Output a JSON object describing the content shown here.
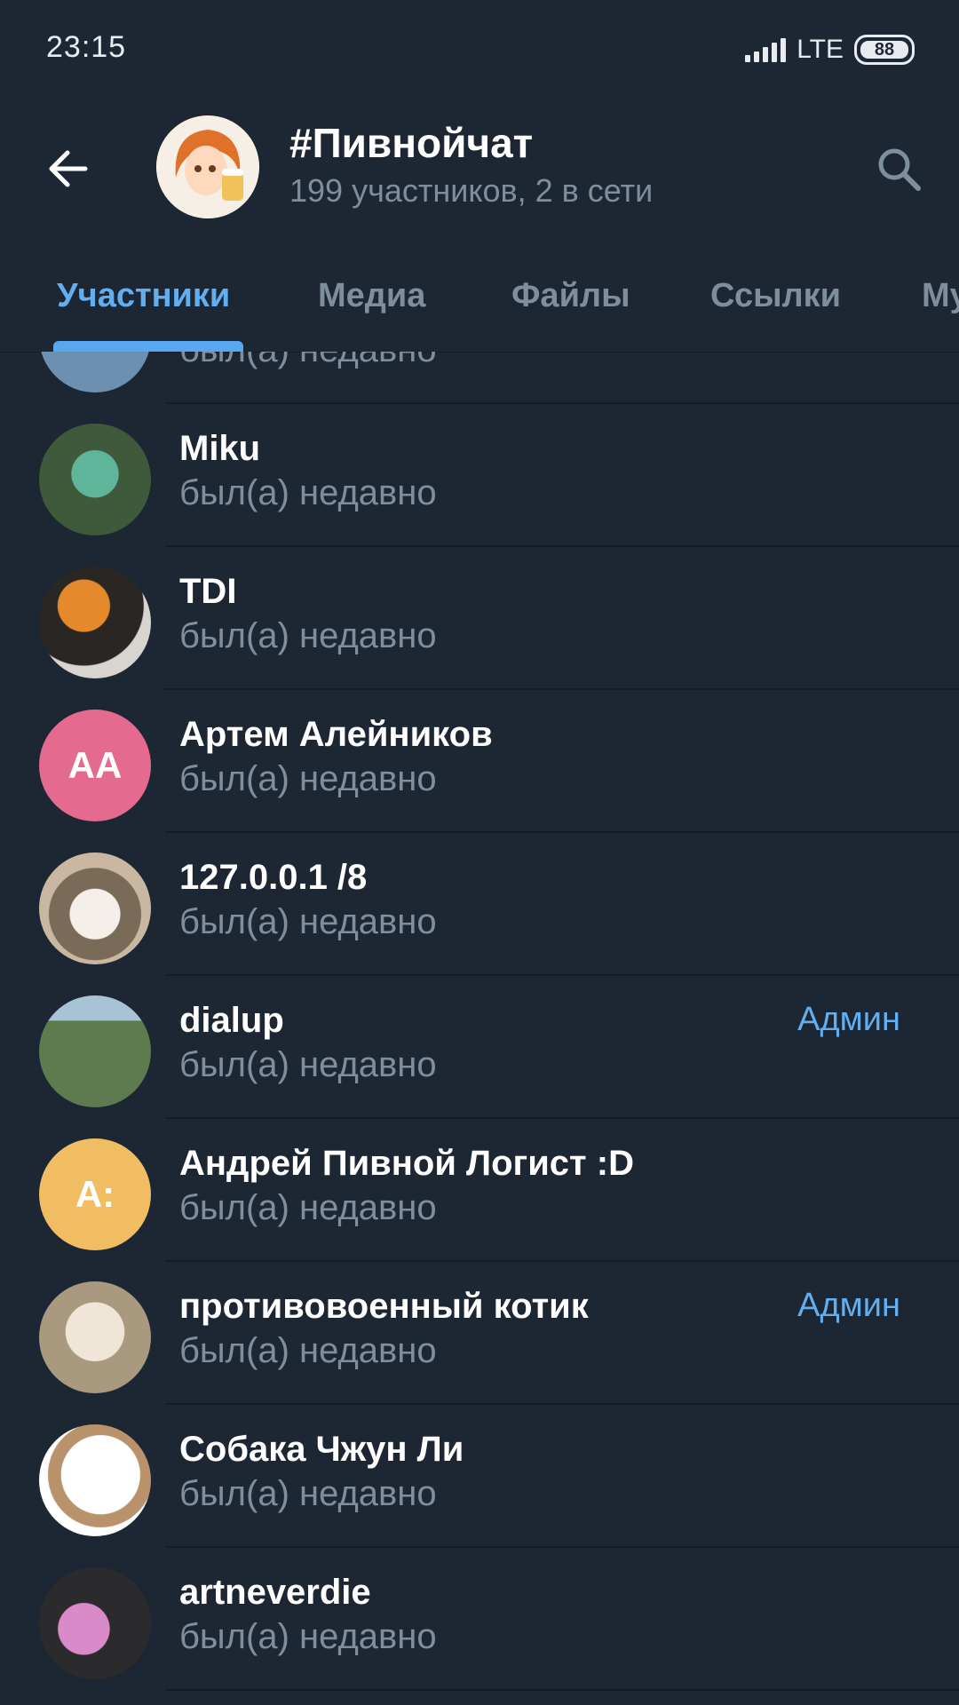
{
  "status_bar": {
    "time": "23:15",
    "network": "LTE",
    "battery": "88"
  },
  "header": {
    "title": "#Пивнойчат",
    "subtitle": "199 участников, 2 в сети"
  },
  "tabs": [
    {
      "label": "Участники",
      "active": true
    },
    {
      "label": "Медиа",
      "active": false
    },
    {
      "label": "Файлы",
      "active": false
    },
    {
      "label": "Ссылки",
      "active": false
    },
    {
      "label": "Му",
      "active": false
    }
  ],
  "members": [
    {
      "name": "",
      "status": "был(а) недавно",
      "badge": "",
      "initials": "",
      "avatar_color": "#6d8fb0"
    },
    {
      "name": "Miku",
      "status": "был(а) недавно",
      "badge": "",
      "initials": "",
      "avatar_color": "#4a6b48"
    },
    {
      "name": "TDI",
      "status": "был(а) недавно",
      "badge": "",
      "initials": "",
      "avatar_color": "#3b3633"
    },
    {
      "name": "Артем Алейников",
      "status": "был(а) недавно",
      "badge": "",
      "initials": "АА",
      "avatar_color": "#e56a8f"
    },
    {
      "name": "127.0.0.1 /8",
      "status": "был(а) недавно",
      "badge": "",
      "initials": "",
      "avatar_color": "#c9b7a2"
    },
    {
      "name": "dialup",
      "status": "был(а) недавно",
      "badge": "Админ",
      "initials": "",
      "avatar_color": "#5e7a4f"
    },
    {
      "name": "Андрей Пивной Логист :D",
      "status": "был(а) недавно",
      "badge": "",
      "initials": "А:",
      "avatar_color": "#f0bd63"
    },
    {
      "name": "противовоенный котик",
      "status": "был(а) недавно",
      "badge": "Админ",
      "initials": "",
      "avatar_color": "#c8bba5"
    },
    {
      "name": "Собака Чжун Ли",
      "status": "был(а) недавно",
      "badge": "",
      "initials": "",
      "avatar_color": "#f3f0ec"
    },
    {
      "name": "artneverdie",
      "status": "был(а) недавно",
      "badge": "",
      "initials": "",
      "avatar_color": "#9a5b88"
    }
  ],
  "colors": {
    "background": "#1d2733",
    "accent": "#61aff0",
    "secondary_text": "#7f8e9c"
  }
}
